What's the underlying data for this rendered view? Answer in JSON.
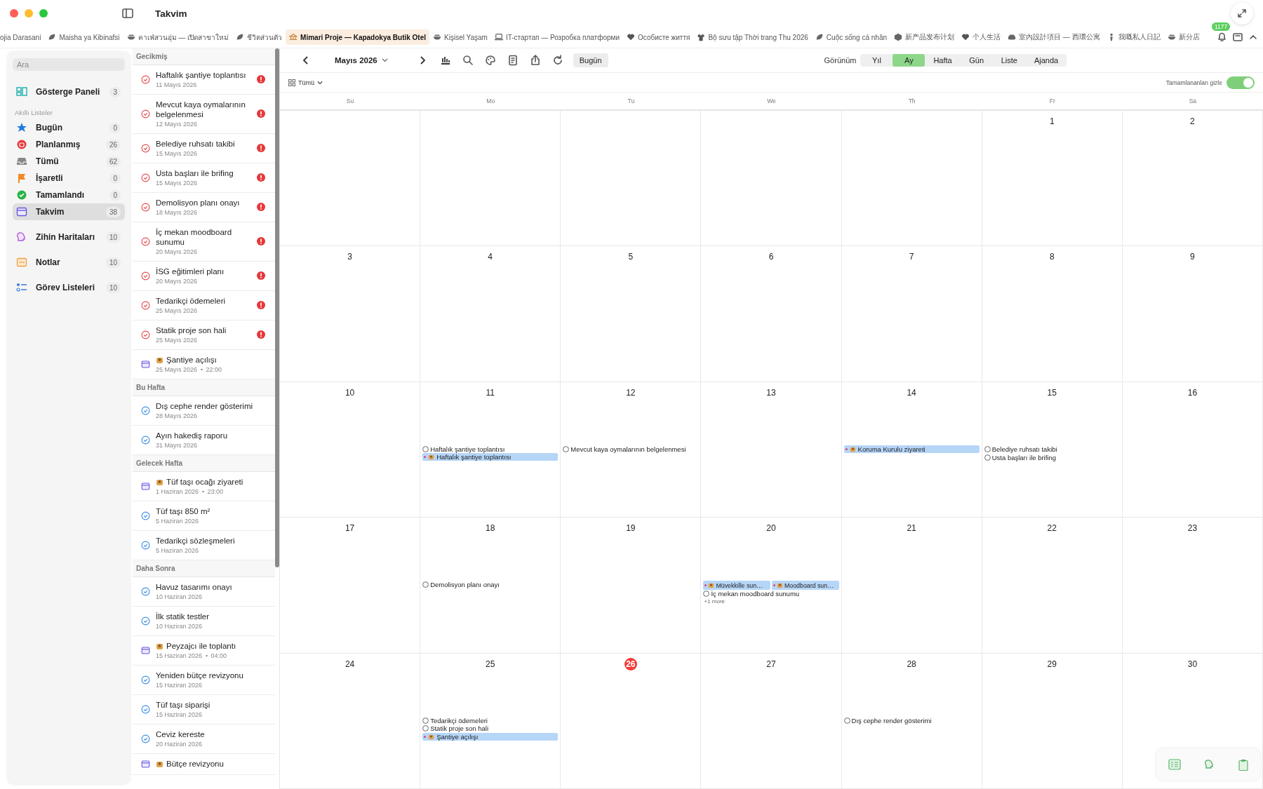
{
  "window": {
    "title": "Takvim"
  },
  "tabs": [
    {
      "label": "ojia Darasani",
      "selected": false
    },
    {
      "label": "Maisha ya Kibinafsi",
      "selected": false
    },
    {
      "label": "คาเฟ่สวนอุ่ม — เปิดสาขาใหม่",
      "selected": false
    },
    {
      "label": "ชีวิตส่วนตัว",
      "selected": false
    },
    {
      "label": "Mimari Proje — Kapadokya Butik Otel",
      "selected": true
    },
    {
      "label": "Kişisel Yaşam",
      "selected": false
    },
    {
      "label": "IT-стартап — Розробка платформи",
      "selected": false
    },
    {
      "label": "Особисте життя",
      "selected": false
    },
    {
      "label": "Bộ sưu tập Thời trang Thu 2026",
      "selected": false
    },
    {
      "label": "Cuộc sống cá nhân",
      "selected": false
    },
    {
      "label": "新产品发布计划",
      "selected": false
    },
    {
      "label": "个人生活",
      "selected": false
    },
    {
      "label": "室內設計項目 — 西環公寓",
      "selected": false
    },
    {
      "label": "我嘅私人日記",
      "selected": false
    },
    {
      "label": "新分店",
      "selected": false
    }
  ],
  "notification_badge": "1177",
  "sidebar": {
    "search": {
      "placeholder": "Ara"
    },
    "sections": [
      {
        "items": [
          {
            "label": "Gösterge Paneli",
            "count": "3",
            "selected": false
          }
        ]
      },
      {
        "title": "Akıllı Listeler",
        "items": [
          {
            "label": "Bugün",
            "count": "0",
            "selected": false
          },
          {
            "label": "Planlanmış",
            "count": "26",
            "selected": false
          },
          {
            "label": "Tümü",
            "count": "62",
            "selected": false
          },
          {
            "label": "İşaretli",
            "count": "0",
            "selected": false
          },
          {
            "label": "Tamamlandı",
            "count": "0",
            "selected": false
          },
          {
            "label": "Takvim",
            "count": "38",
            "selected": true
          }
        ]
      },
      {
        "items": [
          {
            "label": "Zihin Haritaları",
            "count": "10",
            "selected": false
          }
        ]
      },
      {
        "items": [
          {
            "label": "Notlar",
            "count": "10",
            "selected": false
          }
        ]
      },
      {
        "items": [
          {
            "label": "Görev Listeleri",
            "count": "10",
            "selected": false
          }
        ]
      }
    ]
  },
  "task_list": {
    "sections": [
      {
        "title": "Gecikmiş",
        "items": [
          {
            "kind": "task",
            "title": "Haftalık şantiye toplantısı",
            "date": "11 Mayıs 2026",
            "overdue": true
          },
          {
            "kind": "task",
            "title": "Mevcut kaya oymalarının belgelenmesi",
            "date": "12 Mayıs 2026",
            "overdue": true
          },
          {
            "kind": "task",
            "title": "Belediye ruhsatı takibi",
            "date": "15 Mayıs 2026",
            "overdue": true
          },
          {
            "kind": "task",
            "title": "Usta başları ile brifing",
            "date": "15 Mayıs 2026",
            "overdue": true
          },
          {
            "kind": "task",
            "title": "Demolisyon planı onayı",
            "date": "18 Mayıs 2026",
            "overdue": true
          },
          {
            "kind": "task",
            "title": "İç mekan moodboard sunumu",
            "date": "20 Mayıs 2026",
            "overdue": true
          },
          {
            "kind": "task",
            "title": "İSG eğitimleri planı",
            "date": "20 Mayıs 2026",
            "overdue": true
          },
          {
            "kind": "task",
            "title": "Tedarikçi ödemeleri",
            "date": "25 Mayıs 2026",
            "overdue": true
          },
          {
            "kind": "task",
            "title": "Statik proje son hali",
            "date": "25 Mayıs 2026",
            "overdue": true
          },
          {
            "kind": "event",
            "title": "Şantiye açılışı",
            "date": "25 Mayıs 2026",
            "time": "22:00",
            "overdue": false
          }
        ]
      },
      {
        "title": "Bu Hafta",
        "items": [
          {
            "kind": "task",
            "title": "Dış cephe render gösterimi",
            "date": "28 Mayıs 2026",
            "overdue": false
          },
          {
            "kind": "task",
            "title": "Ayın hakediş raporu",
            "date": "31 Mayıs 2026",
            "overdue": false
          }
        ]
      },
      {
        "title": "Gelecek Hafta",
        "items": [
          {
            "kind": "event",
            "title": "Tüf taşı ocağı ziyareti",
            "date": "1 Haziran 2026",
            "time": "23:00",
            "overdue": false
          },
          {
            "kind": "task",
            "title": "Tüf taşı 850 m²",
            "date": "5 Haziran 2026",
            "overdue": false
          },
          {
            "kind": "task",
            "title": "Tedarikçi sözleşmeleri",
            "date": "5 Haziran 2026",
            "overdue": false
          }
        ]
      },
      {
        "title": "Daha Sonra",
        "items": [
          {
            "kind": "task",
            "title": "Havuz tasarımı onayı",
            "date": "10 Haziran 2026",
            "overdue": false
          },
          {
            "kind": "task",
            "title": "İlk statik testler",
            "date": "10 Haziran 2026",
            "overdue": false
          },
          {
            "kind": "event",
            "title": "Peyzajcı ile toplantı",
            "date": "15 Haziran 2026",
            "time": "04:00",
            "overdue": false
          },
          {
            "kind": "task",
            "title": "Yeniden bütçe revizyonu",
            "date": "15 Haziran 2026",
            "overdue": false
          },
          {
            "kind": "task",
            "title": "Tüf taşı siparişi",
            "date": "15 Haziran 2026",
            "overdue": false
          },
          {
            "kind": "task",
            "title": "Ceviz kereste",
            "date": "20 Haziran 2026",
            "overdue": false
          },
          {
            "kind": "event",
            "title": "Bütçe revizyonu",
            "overdue": false
          }
        ]
      }
    ]
  },
  "calendar": {
    "month": "Mayıs 2026",
    "today_button": "Bugün",
    "view_label": "Görünüm",
    "views": [
      {
        "label": "Yıl",
        "selected": false
      },
      {
        "label": "Ay",
        "selected": true
      },
      {
        "label": "Hafta",
        "selected": false
      },
      {
        "label": "Gün",
        "selected": false
      },
      {
        "label": "Liste",
        "selected": false
      },
      {
        "label": "Ajanda",
        "selected": false
      }
    ],
    "filter": "Tümü",
    "hide_completed": {
      "label": "Tamamlananları gizle",
      "on": true
    },
    "weekdays": [
      "Su",
      "Mo",
      "Tu",
      "We",
      "Th",
      "Fr",
      "Sa"
    ],
    "weeks": [
      {
        "days": [
          {
            "day": "1",
            "today": false
          },
          {
            "day": "2",
            "today": false
          }
        ]
      },
      {
        "days": [
          {
            "day": "3",
            "today": false
          },
          {
            "day": "4",
            "today": false
          },
          {
            "day": "5",
            "today": false
          },
          {
            "day": "6",
            "today": false
          },
          {
            "day": "7",
            "today": false
          },
          {
            "day": "8",
            "today": false
          },
          {
            "day": "9",
            "today": false
          }
        ]
      },
      {
        "days": [
          {
            "day": "10",
            "today": false
          },
          {
            "day": "11",
            "today": false,
            "events": [
              {
                "kind": "task",
                "title": "Haftalık şantiye toplantısı"
              },
              {
                "kind": "event",
                "title": "Haftalık şantiye toplantısı"
              }
            ]
          },
          {
            "day": "12",
            "today": false,
            "events": [
              {
                "kind": "task",
                "title": "Mevcut kaya oymalarının belgelenmesi"
              }
            ]
          },
          {
            "day": "13",
            "today": false
          },
          {
            "day": "14",
            "today": false,
            "events": [
              {
                "kind": "event",
                "title": "Koruma Kurulu ziyareti"
              }
            ]
          },
          {
            "day": "15",
            "today": false,
            "events": [
              {
                "kind": "task",
                "title": "Belediye ruhsatı takibi"
              },
              {
                "kind": "task",
                "title": "Usta başları ile brifing"
              }
            ]
          },
          {
            "day": "16",
            "today": false
          }
        ]
      },
      {
        "days": [
          {
            "day": "17",
            "today": false
          },
          {
            "day": "18",
            "today": false,
            "events": [
              {
                "kind": "task",
                "title": "Demolisyon planı onayı"
              }
            ]
          },
          {
            "day": "19",
            "today": false
          },
          {
            "day": "20",
            "today": false,
            "events": [
              {
                "kind": "event-half",
                "title": "Müvekkille sun…"
              },
              {
                "kind": "event-half",
                "title": "Moodboard sun…"
              },
              {
                "kind": "task",
                "title": "İç mekan moodboard sunumu"
              },
              {
                "kind": "more",
                "title": "+1 more"
              }
            ]
          },
          {
            "day": "21",
            "today": false
          },
          {
            "day": "22",
            "today": false
          },
          {
            "day": "23",
            "today": false
          }
        ]
      },
      {
        "days": [
          {
            "day": "24",
            "today": false
          },
          {
            "day": "25",
            "today": false,
            "events": [
              {
                "kind": "task",
                "title": "Tedarikçi ödemeleri"
              },
              {
                "kind": "task",
                "title": "Statik proje son hali"
              },
              {
                "kind": "event",
                "title": "Şantiye açılışı"
              }
            ]
          },
          {
            "day": "26",
            "today": true
          },
          {
            "day": "27",
            "today": false
          },
          {
            "day": "28",
            "today": false,
            "events": [
              {
                "kind": "task",
                "title": "Dış cephe render gösterimi"
              }
            ]
          },
          {
            "day": "29",
            "today": false
          },
          {
            "day": "30",
            "today": false
          }
        ]
      }
    ]
  }
}
